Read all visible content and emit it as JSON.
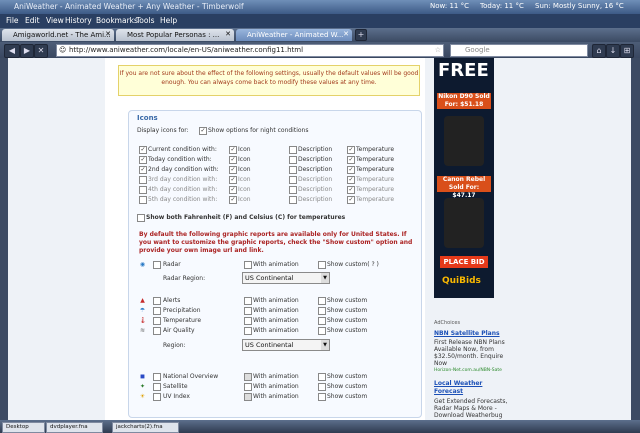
{
  "window": {
    "title": "AniWeather - Animated Weather + Any Weather - Timberwolf"
  },
  "weather_bar": {
    "now": "Now: 11 °C",
    "today": "Today: 11 °C",
    "sun": "Sun: Mostly Sunny, 16 °C"
  },
  "menu": [
    "File",
    "Edit",
    "View",
    "History",
    "Bookmarks",
    "Tools",
    "Help"
  ],
  "tabs": [
    {
      "label": "Amigaworld.net - The Ami..."
    },
    {
      "label": "Most Popular Personas : ..."
    },
    {
      "label": "AniWeather - Animated W..."
    }
  ],
  "nav": {
    "url": "http://www.aniweather.com/locale/en-US/aniweather.config11.html",
    "search_placeholder": "Google"
  },
  "notice": "If you are not sure about the effect of the following settings, usually the default values will be good enough. You can always come back to modify these values at any time.",
  "icons_panel": {
    "title": "Icons",
    "display_icons_for": "Display icons for:",
    "night_option": "Show options for night conditions",
    "rows": [
      {
        "label": "Current condition with:",
        "checked": true,
        "icon": true,
        "desc": false,
        "temp": true
      },
      {
        "label": "Today condition with:",
        "checked": true,
        "icon": true,
        "desc": false,
        "temp": true
      },
      {
        "label": "2nd day condition with:",
        "checked": true,
        "icon": true,
        "desc": false,
        "temp": true
      },
      {
        "label": "3rd day condition with:",
        "checked": false,
        "icon": true,
        "desc": false,
        "temp": true
      },
      {
        "label": "4th day condition with:",
        "checked": false,
        "icon": true,
        "desc": false,
        "temp": true
      },
      {
        "label": "5th day condition with:",
        "checked": false,
        "icon": true,
        "desc": false,
        "temp": true
      }
    ],
    "col_icon": "Icon",
    "col_desc": "Description",
    "col_temp": "Temperature",
    "fahrenheit_option": "Show both Fahrenheit (F) and Celsius (C) for temperatures"
  },
  "warning": "By default the following graphic reports are available only for United States. If you want to customize the graphic reports, check the \"Show custom\" option and provide your own image url and link.",
  "reports": {
    "radar": "Radar",
    "with_animation": "With animation",
    "show_custom": "Show custom",
    "show_custom_help": "Show custom( ? )",
    "radar_region_label": "Radar Region:",
    "radar_region": "US Continental",
    "region_label": "Region:",
    "region": "US Continental",
    "group2": [
      "Alerts",
      "Precipitation",
      "Temperature",
      "Air Quality"
    ],
    "group3": [
      "National Overview",
      "Satellite",
      "UV Index"
    ]
  },
  "ads": {
    "free": "FREE",
    "nikon": "Nikon D90 Sold For: $51.18",
    "canon": "Canon Rebel Sold For: $47.17",
    "place_bid": "PLACE BID",
    "brand": "QuiBids",
    "adchoices": "AdChoices",
    "nbn_title": "NBN Satellite Plans",
    "nbn_text": "First Release NBN Plans Available Now, from $32.50/month. Enquire Now",
    "nbn_url": "Horizon-Net.com.au/NBN-Sate",
    "local_title": "Local Weather Forecast",
    "local_text": "Get Extended Forecasts, Radar Maps & More - Download Weatherbug"
  },
  "taskbar": [
    "Desktop",
    "dvdplayer.fna",
    "jackcharts(2).fna"
  ]
}
